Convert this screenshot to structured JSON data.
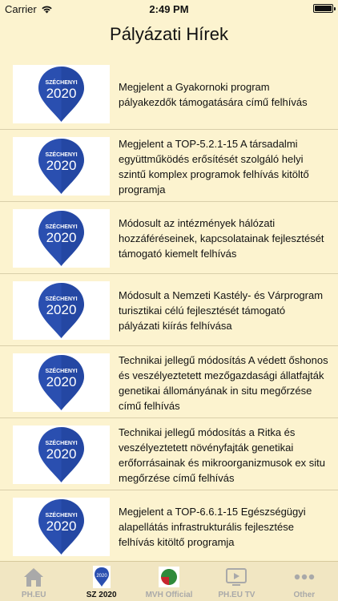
{
  "status": {
    "carrier": "Carrier",
    "time": "2:49 PM",
    "battery_percent": 100
  },
  "title": "Pályázati Hírek",
  "brand": {
    "pin_color": "#2a4fb0",
    "pin_text_top": "SZÉCHENYI",
    "pin_text_year": "2020"
  },
  "items": [
    {
      "text": "Megjelent a Gyakornoki program pályakezdők támogatására című felhívás",
      "icon": "szechenyi-2020-pin"
    },
    {
      "text": "Megjelent a TOP-5.2.1-15 A társadalmi együttműködés erősítését szolgáló helyi szintű komplex programok felhívás kitöltő programja",
      "icon": "szechenyi-2020-pin"
    },
    {
      "text": "Módosult az intézmények hálózati hozzáféréseinek, kapcsolatainak fejlesztését támogató kiemelt felhívás",
      "icon": "szechenyi-2020-pin"
    },
    {
      "text": "Módosult a Nemzeti Kastély- és Várprogram turisztikai célú fejlesztését támogató pályázati kiírás felhívása",
      "icon": "szechenyi-2020-pin"
    },
    {
      "text": "Technikai jellegű módosítás A védett őshonos és veszélyeztetett mezőgazdasági állatfajták genetikai állományának in situ megőrzése című felhívás",
      "icon": "szechenyi-2020-pin"
    },
    {
      "text": "Technikai jellegű módosítás a Ritka és veszélyeztetett növényfajták genetikai erőforrásainak és mikroorganizmusok ex situ megőrzése című felhívás",
      "icon": "szechenyi-2020-pin"
    },
    {
      "text": "Megjelent a TOP-6.6.1-15 Egészségügyi alapellátás infrastrukturális fejlesztése felhívás kitöltő programja",
      "icon": "szechenyi-2020-pin"
    }
  ],
  "tabs": [
    {
      "label": "PH.EU",
      "icon": "house-icon",
      "active": false
    },
    {
      "label": "SZ 2020",
      "icon": "szechenyi-2020-icon",
      "active": true
    },
    {
      "label": "MVH Official",
      "icon": "mvh-logo-icon",
      "active": false
    },
    {
      "label": "PH.EU TV",
      "icon": "tv-icon",
      "active": false
    },
    {
      "label": "Other",
      "icon": "more-icon",
      "active": false
    }
  ]
}
